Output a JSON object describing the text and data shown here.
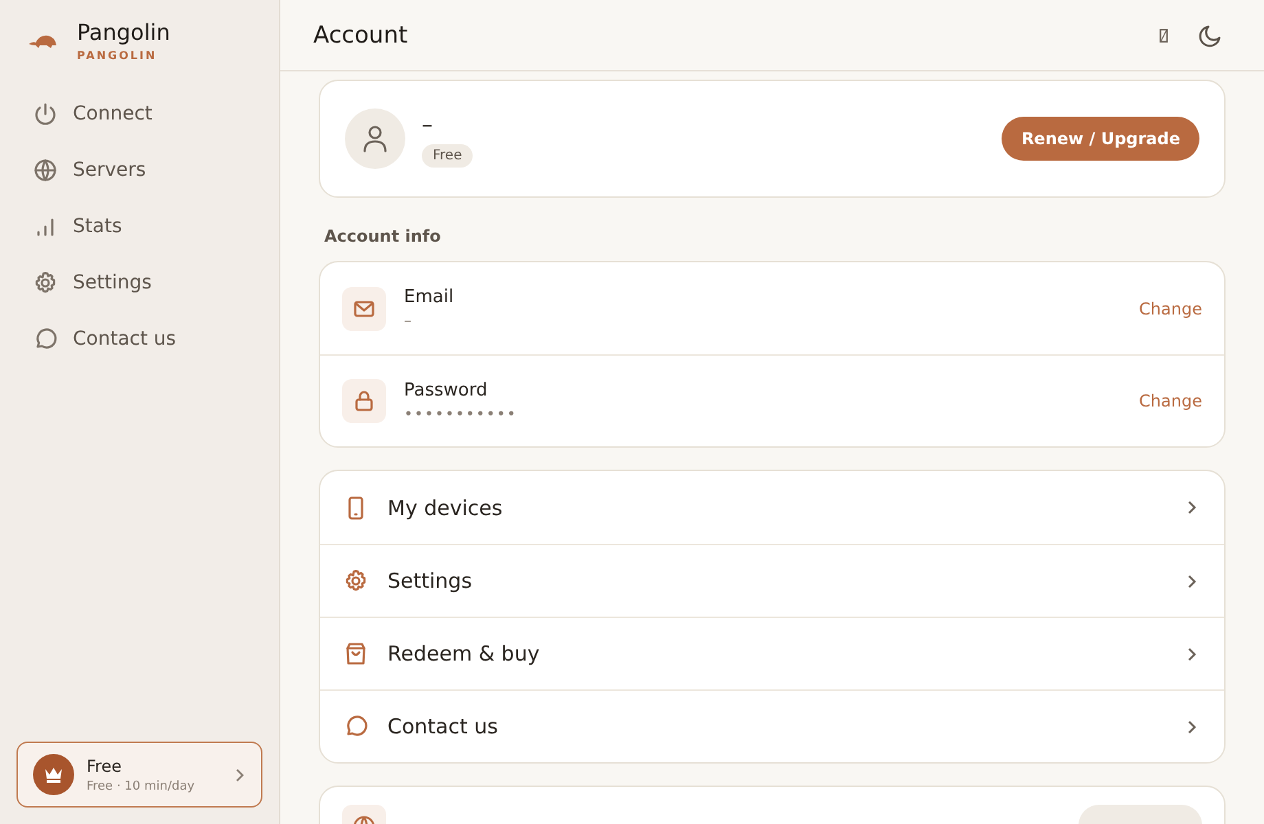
{
  "sidebar": {
    "brand": {
      "name": "Pangolin",
      "subtitle": "PANGOLIN"
    },
    "items": [
      {
        "label": "Connect",
        "kind": "power"
      },
      {
        "label": "Servers",
        "kind": "globe"
      },
      {
        "label": "Stats",
        "kind": "bars"
      },
      {
        "label": "Settings",
        "kind": "gear"
      },
      {
        "label": "Contact us",
        "kind": "chat"
      }
    ],
    "plan_card": {
      "title": "Free",
      "detail": "Free · 10 min/day"
    }
  },
  "header": {
    "title": "Account"
  },
  "profile": {
    "name": "–",
    "plan_badge": "Free",
    "button": "Renew / Upgrade"
  },
  "account_info": {
    "heading": "Account info",
    "rows": [
      {
        "label": "Email",
        "value": "–",
        "kind": "mail",
        "action": "Change"
      },
      {
        "label": "Password",
        "value": "•••••••••••",
        "kind": "lock",
        "action": "Change"
      }
    ]
  },
  "links": [
    {
      "label": "My devices",
      "kind": "phone"
    },
    {
      "label": "Settings",
      "kind": "gear"
    },
    {
      "label": "Redeem & buy",
      "kind": "bag"
    },
    {
      "label": "Contact us",
      "kind": "chat"
    }
  ]
}
